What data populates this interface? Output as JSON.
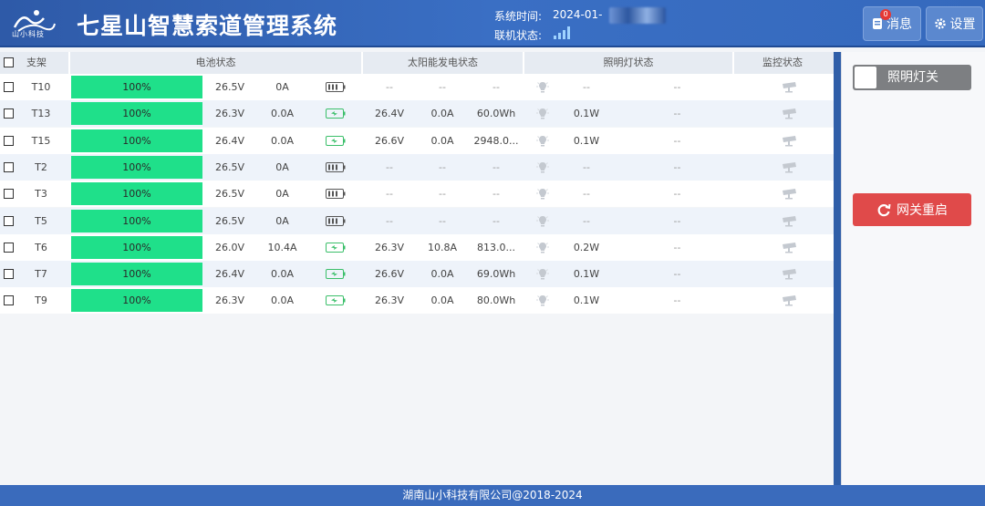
{
  "header": {
    "logo_text": "山小科技",
    "title": "七星山智慧索道管理系统",
    "sys_time_label": "系统时间:",
    "sys_time_value": "2024-01-",
    "online_label": "联机状态:",
    "messages_label": "消息",
    "messages_badge": "0",
    "settings_label": "设置"
  },
  "table": {
    "headers": {
      "support": "支架",
      "battery": "电池状态",
      "solar": "太阳能发电状态",
      "lighting": "照明灯状态",
      "monitor": "监控状态"
    },
    "rows": [
      {
        "id": "T10",
        "pct": "100%",
        "bv": "26.5V",
        "ba": "0A",
        "charging": false,
        "sv": "--",
        "sa": "--",
        "sw": "--",
        "lw": "--",
        "lx": "--"
      },
      {
        "id": "T13",
        "pct": "100%",
        "bv": "26.3V",
        "ba": "0.0A",
        "charging": true,
        "sv": "26.4V",
        "sa": "0.0A",
        "sw": "60.0Wh",
        "lw": "0.1W",
        "lx": "--"
      },
      {
        "id": "T15",
        "pct": "100%",
        "bv": "26.4V",
        "ba": "0.0A",
        "charging": true,
        "sv": "26.6V",
        "sa": "0.0A",
        "sw": "2948.0...",
        "lw": "0.1W",
        "lx": "--"
      },
      {
        "id": "T2",
        "pct": "100%",
        "bv": "26.5V",
        "ba": "0A",
        "charging": false,
        "sv": "--",
        "sa": "--",
        "sw": "--",
        "lw": "--",
        "lx": "--"
      },
      {
        "id": "T3",
        "pct": "100%",
        "bv": "26.5V",
        "ba": "0A",
        "charging": false,
        "sv": "--",
        "sa": "--",
        "sw": "--",
        "lw": "--",
        "lx": "--"
      },
      {
        "id": "T5",
        "pct": "100%",
        "bv": "26.5V",
        "ba": "0A",
        "charging": false,
        "sv": "--",
        "sa": "--",
        "sw": "--",
        "lw": "--",
        "lx": "--"
      },
      {
        "id": "T6",
        "pct": "100%",
        "bv": "26.0V",
        "ba": "10.4A",
        "charging": true,
        "sv": "26.3V",
        "sa": "10.8A",
        "sw": "813.0...",
        "lw": "0.2W",
        "lx": "--"
      },
      {
        "id": "T7",
        "pct": "100%",
        "bv": "26.4V",
        "ba": "0.0A",
        "charging": true,
        "sv": "26.6V",
        "sa": "0.0A",
        "sw": "69.0Wh",
        "lw": "0.1W",
        "lx": "--"
      },
      {
        "id": "T9",
        "pct": "100%",
        "bv": "26.3V",
        "ba": "0.0A",
        "charging": true,
        "sv": "26.3V",
        "sa": "0.0A",
        "sw": "80.0Wh",
        "lw": "0.1W",
        "lx": "--"
      }
    ]
  },
  "right_panel": {
    "toggle_label": "照明灯关",
    "restart_label": "网关重启"
  },
  "footer": {
    "text": "湖南山小科技有限公司@2018-2024"
  },
  "colors": {
    "battery_bar": "#1fe08a",
    "header": "#3a6fc4",
    "restart": "#e04a4a",
    "toggle": "#7d7f82"
  }
}
